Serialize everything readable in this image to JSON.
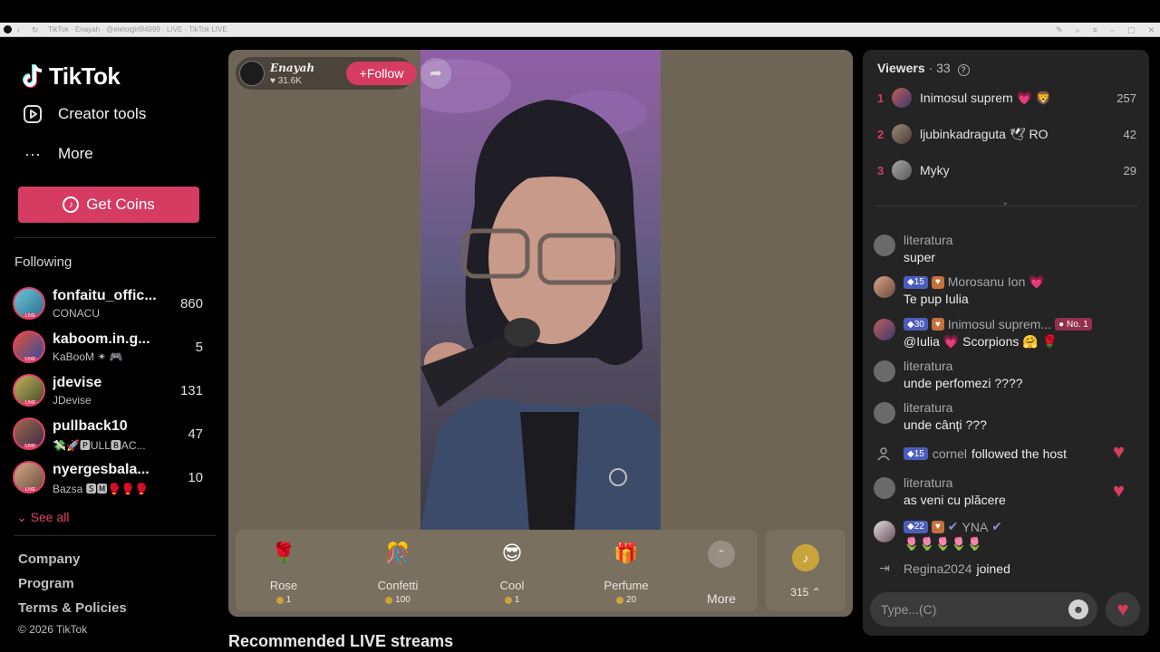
{
  "browser": {
    "tab_text": "TikTok · Enayah · @elelolgirl94999 · LIVE · TikTok LIVE"
  },
  "sidebar": {
    "logo": "TikTok",
    "nav": [
      {
        "label": "Creator tools",
        "icon": "play-square-icon"
      },
      {
        "label": "More",
        "icon": "ellipsis-icon"
      }
    ],
    "get_coins": "Get Coins",
    "following_title": "Following",
    "following": [
      {
        "name": "fonfaitu_offic...",
        "sub": "CONACU",
        "count": "860"
      },
      {
        "name": "kaboom.in.g...",
        "sub": "KaBooM ✴ 🎮",
        "count": "5"
      },
      {
        "name": "jdevise",
        "sub": "JDevise",
        "count": "131"
      },
      {
        "name": "pullback10",
        "sub": "💸🚀🅿ULL🅱AC...",
        "count": "47"
      },
      {
        "name": "nyergesbala...",
        "sub": "Bazsa 🆂🅼🥊🥊🥊",
        "count": "10"
      }
    ],
    "see_all": "See all",
    "footer": [
      "Company",
      "Program",
      "Terms & Policies"
    ],
    "copyright": "© 2026 TikTok"
  },
  "live": {
    "host_name": "Enayah",
    "host_likes": "31.6K",
    "follow_label": "Follow",
    "gifts": [
      {
        "name": "Rose",
        "price": "1",
        "icon": "🌹"
      },
      {
        "name": "Confetti",
        "price": "100",
        "icon": "🎊"
      },
      {
        "name": "Cool",
        "price": "1",
        "icon": "😎"
      },
      {
        "name": "Perfume",
        "price": "20",
        "icon": "🎁"
      }
    ],
    "more_label": "More",
    "coin_balance": "315"
  },
  "recommended_title": "Recommended LIVE streams",
  "viewers": {
    "title": "Viewers",
    "count": "33",
    "list": [
      {
        "rank": "1",
        "name": "Inimosul suprem 💗 🦁",
        "score": "257"
      },
      {
        "rank": "2",
        "name": "ljubinkadraguta 🕊 RO",
        "score": "42"
      },
      {
        "rank": "3",
        "name": "Myky",
        "score": "29"
      }
    ]
  },
  "chat": [
    {
      "user": "literatura",
      "msg": "super"
    },
    {
      "user": "Morosanu Ion 💗",
      "level": "15",
      "msg": "Te pup Iulia"
    },
    {
      "user": "Inimosul suprem...",
      "level": "30",
      "rank_badge": "No. 1",
      "msg": "@Iulia 💗 Scorpions 🤗 🌹"
    },
    {
      "user": "literatura",
      "msg": "unde perfomezi ????"
    },
    {
      "user": "literatura",
      "msg": "unde cânți ???"
    },
    {
      "user": "literatura",
      "msg": "as veni cu plăcere"
    },
    {
      "user": "YNA",
      "level": "22",
      "msg": "🌷🌷🌷🌷🌷"
    }
  ],
  "system": {
    "followed_user": "cornel",
    "followed_level": "15",
    "followed_text": "followed the host",
    "joined_user": "Regina2024",
    "joined_text": "joined"
  },
  "input": {
    "placeholder": "Type...(C)"
  }
}
